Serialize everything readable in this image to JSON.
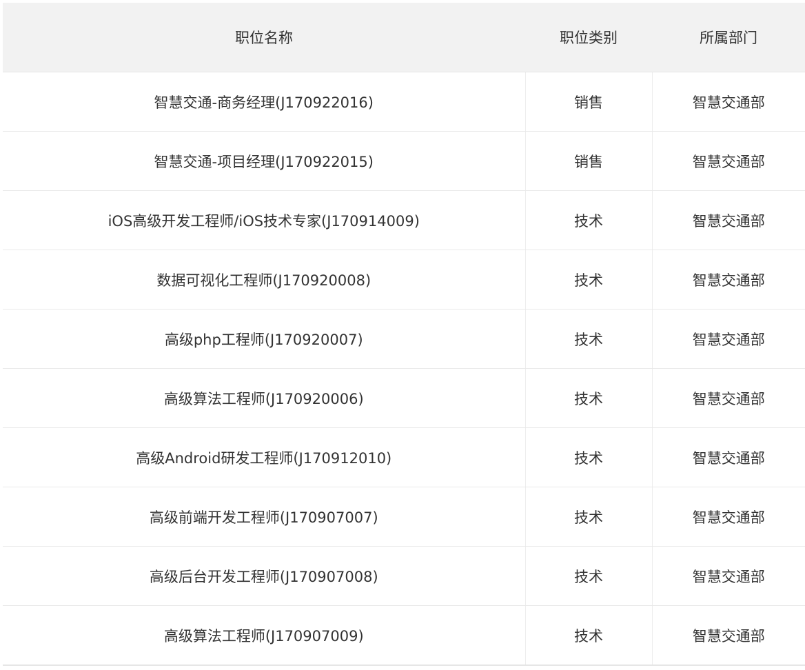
{
  "table": {
    "headers": [
      "职位名称",
      "职位类别",
      "所属部门"
    ],
    "rows": [
      {
        "title": "智慧交通-商务经理(J170922016)",
        "category": "销售",
        "department": "智慧交通部"
      },
      {
        "title": "智慧交通-项目经理(J170922015)",
        "category": "销售",
        "department": "智慧交通部"
      },
      {
        "title": "iOS高级开发工程师/iOS技术专家(J170914009)",
        "category": "技术",
        "department": "智慧交通部"
      },
      {
        "title": "数据可视化工程师(J170920008)",
        "category": "技术",
        "department": "智慧交通部"
      },
      {
        "title": "高级php工程师(J170920007)",
        "category": "技术",
        "department": "智慧交通部"
      },
      {
        "title": "高级算法工程师(J170920006)",
        "category": "技术",
        "department": "智慧交通部"
      },
      {
        "title": "高级Android研发工程师(J170912010)",
        "category": "技术",
        "department": "智慧交通部"
      },
      {
        "title": "高级前端开发工程师(J170907007)",
        "category": "技术",
        "department": "智慧交通部"
      },
      {
        "title": "高级后台开发工程师(J170907008)",
        "category": "技术",
        "department": "智慧交通部"
      },
      {
        "title": "高级算法工程师(J170907009)",
        "category": "技术",
        "department": "智慧交通部"
      }
    ]
  }
}
